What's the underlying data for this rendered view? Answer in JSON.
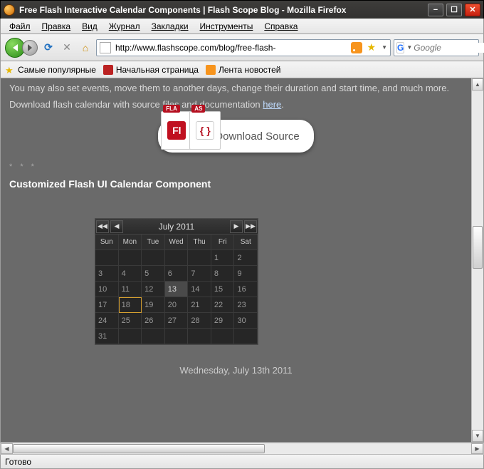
{
  "window": {
    "title": "Free Flash Interactive Calendar Components | Flash Scope Blog - Mozilla Firefox"
  },
  "menu": {
    "file": "Файл",
    "edit": "Правка",
    "view": "Вид",
    "history": "Журнал",
    "bookmarks": "Закладки",
    "tools": "Инструменты",
    "help": "Справка"
  },
  "toolbar": {
    "url": "http://www.flashscope.com/blog/free-flash-",
    "search_placeholder": "Google",
    "search_engine_letter": "G"
  },
  "bookmarks": {
    "popular": "Самые популярные",
    "homepage": "Начальная страница",
    "news": "Лента новостей"
  },
  "content": {
    "line1": "You may also set events, move them to another days, change their duration and start time, and much more.",
    "line2_a": "Download flash calendar with source files and documentation ",
    "line2_link": "here",
    "line2_b": ".",
    "download_label": "Download Source",
    "fla_tag": "FLA",
    "as_tag": "AS",
    "fl_glyph": "Fl",
    "brace_glyph": "{ }",
    "stars": "* * *",
    "section": "Customized Flash UI Calendar Component",
    "date_text": "Wednesday, July 13th 2011"
  },
  "calendar": {
    "title": "July  2011",
    "days": [
      "Sun",
      "Mon",
      "Tue",
      "Wed",
      "Thu",
      "Fri",
      "Sat"
    ],
    "rows": [
      [
        "",
        "",
        "",
        "",
        "",
        "1",
        "2"
      ],
      [
        "3",
        "4",
        "5",
        "6",
        "7",
        "8",
        "9"
      ],
      [
        "10",
        "11",
        "12",
        "13",
        "14",
        "15",
        "16"
      ],
      [
        "17",
        "18",
        "19",
        "20",
        "21",
        "22",
        "23"
      ],
      [
        "24",
        "25",
        "26",
        "27",
        "28",
        "29",
        "30"
      ],
      [
        "31",
        "",
        "",
        "",
        "",
        "",
        ""
      ]
    ],
    "highlighted": "13",
    "today": "18"
  },
  "status": {
    "text": "Готово"
  }
}
